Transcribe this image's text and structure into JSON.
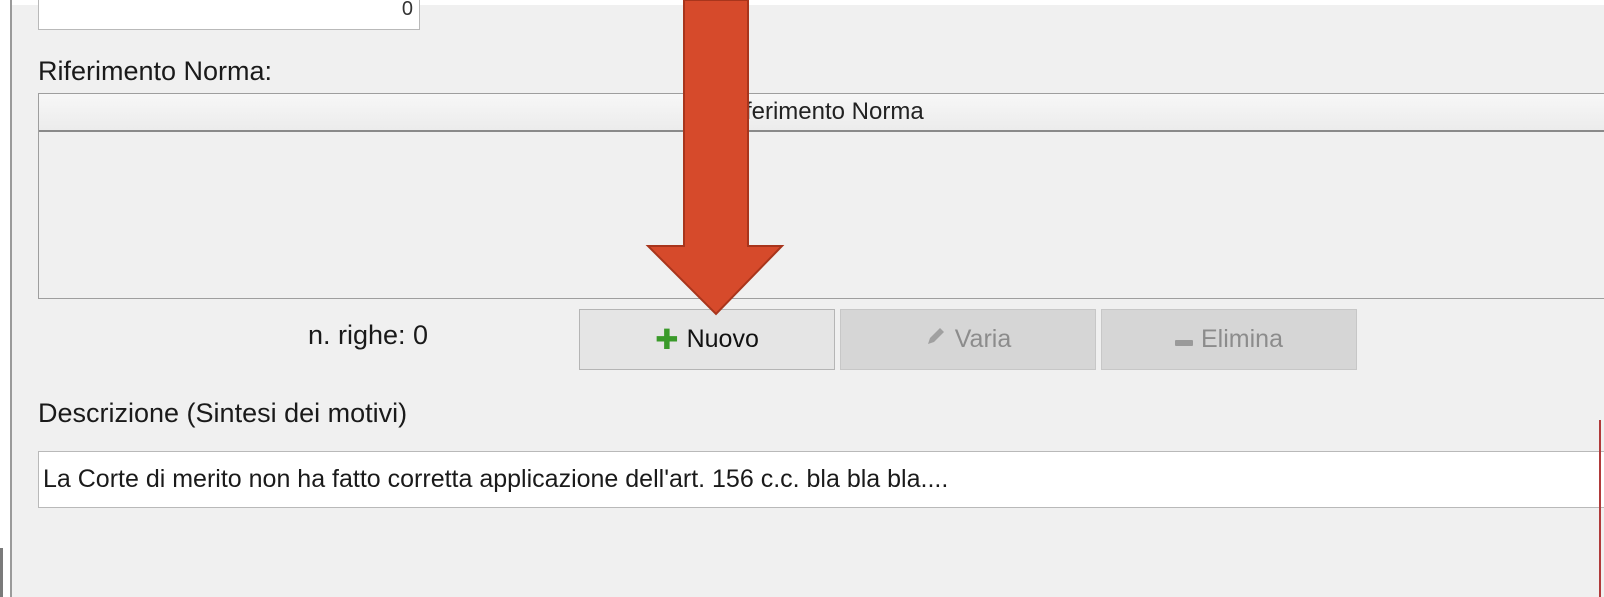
{
  "top_field": {
    "value": "0"
  },
  "norm_section": {
    "label": "Riferimento Norma:",
    "table": {
      "column_header": "Riferimento Norma",
      "rows": []
    },
    "row_count_text": "n. righe: 0"
  },
  "buttons": {
    "new": {
      "label": "Nuovo",
      "icon": "plus-icon",
      "enabled": true
    },
    "edit": {
      "label": "Varia",
      "icon": "pencil-icon",
      "enabled": false
    },
    "delete": {
      "label": "Elimina",
      "icon": "minus-icon",
      "enabled": false
    }
  },
  "description": {
    "label": "Descrizione (Sintesi dei motivi)",
    "value": "La Corte di merito non ha fatto corretta applicazione dell'art. 156 c.c. bla bla bla...."
  },
  "annotation": {
    "color": "#d64a2b",
    "points_to": "Nuovo"
  }
}
